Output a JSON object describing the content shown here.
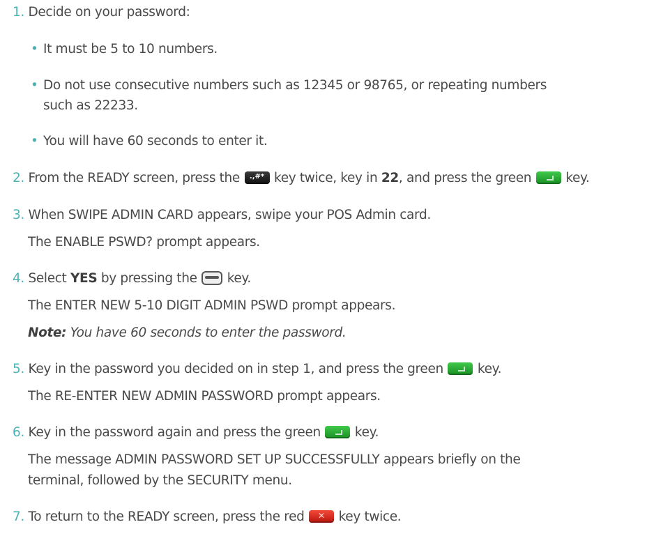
{
  "steps": [
    {
      "num": "1.",
      "text": "Decide on your password:",
      "bullets": [
        "It must be 5 to 10 numbers.",
        "Do not use consecutive numbers such as 12345 or 98765, or repeating numbers",
        "such as 22233.",
        "You will have 60 seconds to enter it."
      ]
    },
    {
      "num": "2.",
      "a": "From the READY screen, press the",
      "b": "key twice, key in",
      "bold": "22",
      "c": ", and press the green",
      "d": "key."
    },
    {
      "num": "3.",
      "text": "When SWIPE ADMIN CARD appears, swipe your POS Admin card.",
      "result": "The ENABLE PSWD? prompt appears."
    },
    {
      "num": "4.",
      "a": "Select",
      "bold": "YES",
      "b": "by pressing the",
      "c": "key.",
      "result": "The ENTER NEW 5-10 DIGIT ADMIN PSWD prompt appears.",
      "note_label": "Note:",
      "note_text": "You have 60 seconds to enter the password."
    },
    {
      "num": "5.",
      "a": "Key in the password you decided on in step 1, and press the green",
      "b": "key.",
      "result": "The RE-ENTER NEW ADMIN PASSWORD prompt appears."
    },
    {
      "num": "6.",
      "a": "Key in the password again and press the green",
      "b": "key.",
      "result_1": "The message ADMIN PASSWORD SET UP SUCCESSFULLY appears briefly on the",
      "result_2": "terminal, followed by the SECURITY menu."
    },
    {
      "num": "7.",
      "a": "To return to the READY screen, press the red",
      "b": "key twice."
    }
  ],
  "keys": {
    "hash_key_glyph": ".,#*",
    "red_key_glyph": "✕"
  },
  "colors": {
    "numbering": "#4bb3b3",
    "text": "#4a4a4a",
    "green_key": "#2aa834",
    "red_key": "#d9261a"
  }
}
